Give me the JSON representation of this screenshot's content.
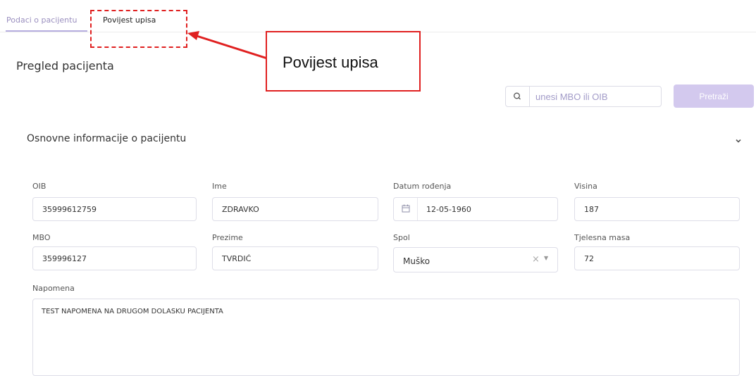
{
  "tabs": [
    {
      "label": "Podaci o pacijentu"
    },
    {
      "label": "Povijest upisa"
    }
  ],
  "annotation": {
    "callout_text": "Povijest upisa",
    "color": "#e02020"
  },
  "page": {
    "title": "Pregled pacijenta"
  },
  "search": {
    "placeholder": "unesi MBO ili OIB",
    "button_label": "Pretraži",
    "icon": "search-icon"
  },
  "section": {
    "title": "Osnovne informacije o pacijentu",
    "collapse_icon": "chevron-down-icon"
  },
  "fields": {
    "oib": {
      "label": "OIB",
      "value": "35999612759"
    },
    "ime": {
      "label": "Ime",
      "value": "ZDRAVKO"
    },
    "datum": {
      "label": "Datum rođenja",
      "value": "12-05-1960",
      "icon": "calendar-icon"
    },
    "visina": {
      "label": "Visina",
      "value": "187"
    },
    "mbo": {
      "label": "MBO",
      "value": "359996127"
    },
    "prezime": {
      "label": "Prezime",
      "value": "TVRDIĆ"
    },
    "spol": {
      "label": "Spol",
      "value": "Muško",
      "clear_glyph": "×",
      "caret_glyph": "▼"
    },
    "masa": {
      "label": "Tjelesna masa",
      "value": "72"
    },
    "napomena": {
      "label": "Napomena",
      "value": "TEST NAPOMENA NA DRUGOM DOLASKU PACIJENTA"
    }
  },
  "colors": {
    "accent": "#b7aee0",
    "button_bg": "#d3c9ee",
    "placeholder": "#a29bc8"
  }
}
